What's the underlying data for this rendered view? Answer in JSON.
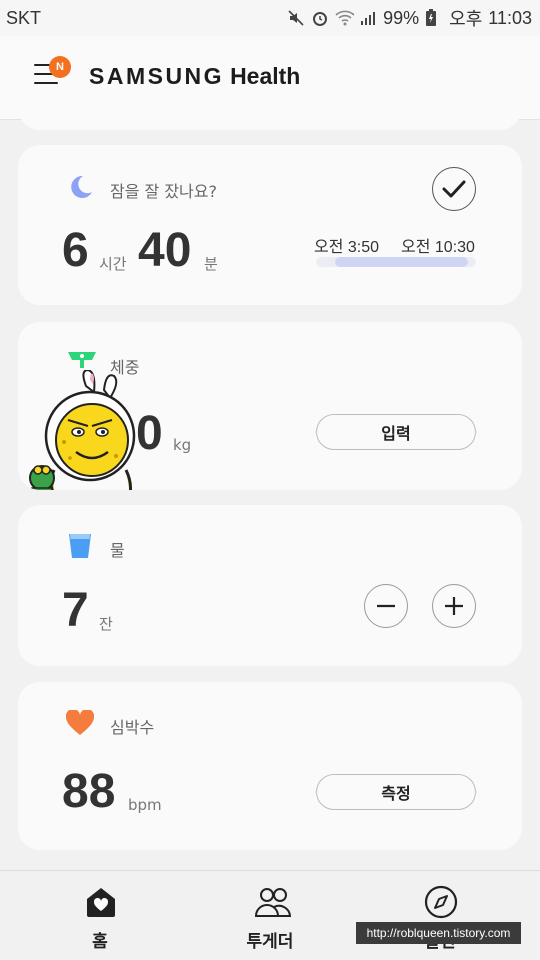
{
  "status_bar": {
    "carrier": "SKT",
    "battery": "99%",
    "ampm": "오후",
    "time": "11:03"
  },
  "header": {
    "notification_badge": "N",
    "brand": "SAMSUNG",
    "app": "Health"
  },
  "cards": {
    "sleep": {
      "title": "잠을 잘 잤나요?",
      "hours": "6",
      "hours_unit": "시간",
      "minutes": "40",
      "minutes_unit": "분",
      "start_ampm": "오전",
      "start_time": "3:50",
      "end_ampm": "오전",
      "end_time": "10:30"
    },
    "weight": {
      "title": "체중",
      "value": "0",
      "unit": "kg",
      "button": "입력"
    },
    "water": {
      "title": "물",
      "value": "7",
      "unit": "잔"
    },
    "heart": {
      "title": "심박수",
      "value": "88",
      "unit": "bpm",
      "button": "측정"
    }
  },
  "bottom_nav": {
    "home": "홈",
    "together": "투게더",
    "discover": "발견"
  },
  "watermark": "http://roblqueen.tistory.com",
  "colors": {
    "badge": "#f37021",
    "sleep_icon": "#8ea2f5",
    "weight_icon": "#2ed47a",
    "water_icon": "#4a9ff5",
    "heart_icon": "#f47c3c"
  }
}
